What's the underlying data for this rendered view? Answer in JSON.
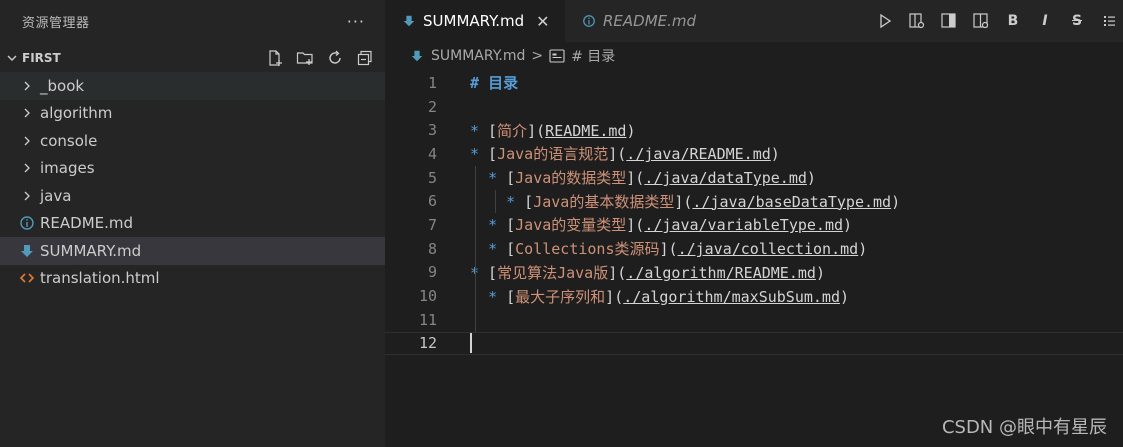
{
  "sidebar": {
    "title": "资源管理器",
    "more": "···",
    "section_title": "FIRST",
    "items": [
      {
        "label": "_book",
        "kind": "folder"
      },
      {
        "label": "algorithm",
        "kind": "folder"
      },
      {
        "label": "console",
        "kind": "folder"
      },
      {
        "label": "images",
        "kind": "folder"
      },
      {
        "label": "java",
        "kind": "folder"
      },
      {
        "label": "README.md",
        "kind": "info-file"
      },
      {
        "label": "SUMMARY.md",
        "kind": "markdown-file"
      },
      {
        "label": "translation.html",
        "kind": "html-file"
      }
    ]
  },
  "tabs": [
    {
      "label": "SUMMARY.md",
      "active": true,
      "close": "✕"
    },
    {
      "label": "README.md",
      "active": false
    }
  ],
  "toolbar": {
    "bold": "B",
    "italic": "I",
    "strike": "S"
  },
  "breadcrumb": {
    "file": "SUMMARY.md",
    "sep": ">",
    "symbol": "# 目录"
  },
  "editor": {
    "line_numbers": [
      "1",
      "2",
      "3",
      "4",
      "5",
      "6",
      "7",
      "8",
      "9",
      "10",
      "11",
      "12"
    ],
    "current_line": 12
  },
  "code": {
    "l1_hash": "#",
    "l1_title": "目录",
    "l3_bullet": "*",
    "l3_open": "[",
    "l3_text": "简介",
    "l3_mid": "](",
    "l3_link": "README.md",
    "l3_close": ")",
    "l4_bullet": "*",
    "l4_text": "Java的语言规范",
    "l4_link": "./java/README.md",
    "l5_bullet": "*",
    "l5_text": "Java的数据类型",
    "l5_link": "./java/dataType.md",
    "l6_bullet": "*",
    "l6_text": "Java的基本数据类型",
    "l6_link": "./java/baseDataType.md",
    "l7_bullet": "*",
    "l7_text": "Java的变量类型",
    "l7_link": "./java/variableType.md",
    "l8_bullet": "*",
    "l8_text": "Collections类源码",
    "l8_link": "./java/collection.md",
    "l9_bullet": "*",
    "l9_text": "常见算法Java版",
    "l9_link": "./algorithm/README.md",
    "l10_bullet": "*",
    "l10_text": "最大子序列和",
    "l10_link": "./algorithm/maxSubSum.md"
  },
  "watermark": "CSDN @眼中有星辰",
  "colors": {
    "sidebar_bg": "#252526",
    "editor_bg": "#1e1e1e",
    "heading_blue": "#569cd6",
    "link_text_orange": "#ce9178",
    "md_icon_blue": "#519aba",
    "html_icon_orange": "#e37933"
  }
}
